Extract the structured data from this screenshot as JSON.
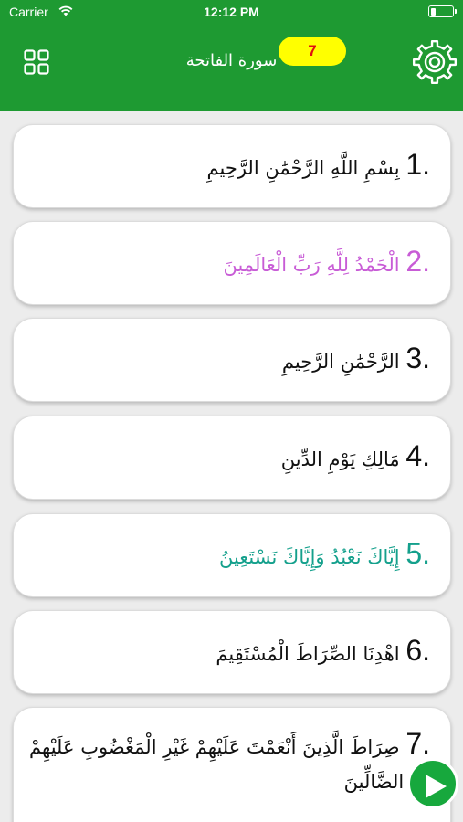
{
  "status_bar": {
    "carrier": "Carrier",
    "time": "12:12 PM",
    "battery_level": 0.2
  },
  "header": {
    "title": "سورة الفاتحة",
    "badge_count": "7",
    "background_color": "#1e9a32",
    "badge_color": "#ffff00",
    "menu_icon": "grid-icon",
    "settings_icon": "gear-icon"
  },
  "verses": [
    {
      "number": "1.",
      "text": "بِسْمِ اللَّهِ الرَّحْمَٰنِ الرَّحِيمِ",
      "color": "#111111"
    },
    {
      "number": "2.",
      "text": "الْحَمْدُ لِلَّهِ رَبِّ الْعَالَمِينَ",
      "color": "#c85cd6"
    },
    {
      "number": "3.",
      "text": "الرَّحْمَٰنِ الرَّحِيمِ",
      "color": "#111111"
    },
    {
      "number": "4.",
      "text": "مَالِكِ يَوْمِ الدِّينِ",
      "color": "#111111"
    },
    {
      "number": "5.",
      "text": "إِيَّاكَ نَعْبُدُ وَإِيَّاكَ نَسْتَعِينُ",
      "color": "#14a08c"
    },
    {
      "number": "6.",
      "text": "اهْدِنَا الصِّرَاطَ الْمُسْتَقِيمَ",
      "color": "#111111"
    },
    {
      "number": "7.",
      "text": "صِرَاطَ الَّذِينَ أَنْعَمْتَ عَلَيْهِمْ غَيْرِ الْمَغْضُوبِ عَلَيْهِمْ وَلَا الضَّالِّينَ",
      "color": "#111111"
    }
  ],
  "play_button": {
    "icon": "play-icon",
    "color": "#17a83d"
  }
}
